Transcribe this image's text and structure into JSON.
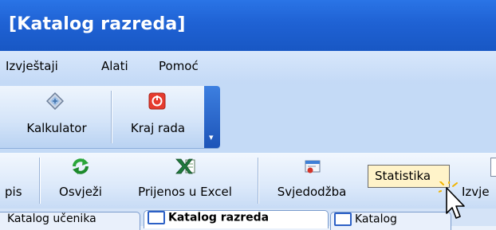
{
  "window": {
    "title": "[Katalog razreda]"
  },
  "menu": {
    "items": [
      "Izvještaji",
      "Alati",
      "Pomoć"
    ]
  },
  "toolbar_top": {
    "buttons": [
      {
        "label": "Kalkulator",
        "icon": "calculator-icon"
      },
      {
        "label": "Kraj rada",
        "icon": "power-icon"
      }
    ]
  },
  "toolbar_main": {
    "buttons": [
      {
        "label": "pis"
      },
      {
        "label": "Osvježi",
        "icon": "refresh-icon"
      },
      {
        "label": "Prijenos u Excel",
        "icon": "excel-icon"
      },
      {
        "label": "Svjedodžba",
        "icon": "certificate-icon"
      },
      {
        "label": "Izvje"
      }
    ]
  },
  "tooltip": {
    "text": "Statistika"
  },
  "tabs": [
    "Katalog učenika",
    "Katalog razreda",
    "Katalog"
  ],
  "colors": {
    "titlebar": "#1f62d4",
    "accent": "#2d61c6"
  }
}
